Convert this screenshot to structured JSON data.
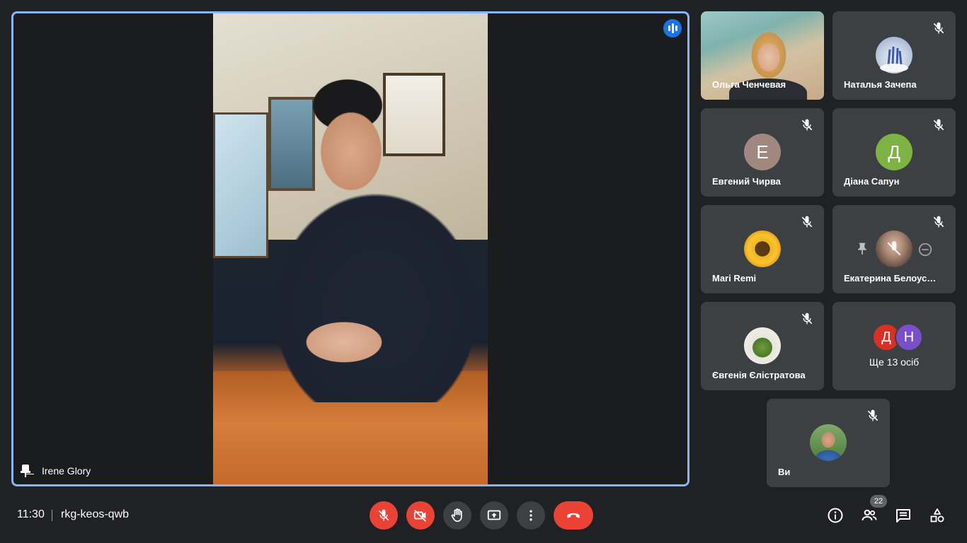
{
  "main_stage": {
    "presenter_name": "Irene Glory"
  },
  "participants": [
    {
      "name": "Ольга Ченчевая",
      "type": "video",
      "muted": false
    },
    {
      "name": "Наталья Зачепа",
      "type": "photo",
      "muted": true
    },
    {
      "name": "Евгений Чирва",
      "type": "initial",
      "initial": "Е",
      "color": "#a1887f",
      "muted": true
    },
    {
      "name": "Діана Сапун",
      "type": "initial",
      "initial": "Д",
      "color": "#7cb342",
      "muted": true
    },
    {
      "name": "Mari Remi",
      "type": "photo",
      "muted": true
    },
    {
      "name": "Екатерина Белоусова",
      "display_name": "Екатерина Белоус…",
      "type": "photo",
      "muted": true,
      "pinned_controls": true
    },
    {
      "name": "Євгенія Єлістратова",
      "type": "photo",
      "muted": true
    },
    {
      "name": "Ви",
      "type": "photo",
      "muted": true
    }
  ],
  "more_tile": {
    "avatars": [
      {
        "initial": "Д",
        "color": "#d93025"
      },
      {
        "initial": "Н",
        "color": "#7b4fc9"
      }
    ],
    "label": "Ще 13 осіб"
  },
  "bottom_bar": {
    "time": "11:30",
    "meeting_code": "rkg-keos-qwb",
    "participants_count": "22"
  },
  "colors": {
    "accent": "#8ab4f8",
    "danger": "#ea4335",
    "tile_bg": "#3c4043",
    "background": "#202124"
  }
}
